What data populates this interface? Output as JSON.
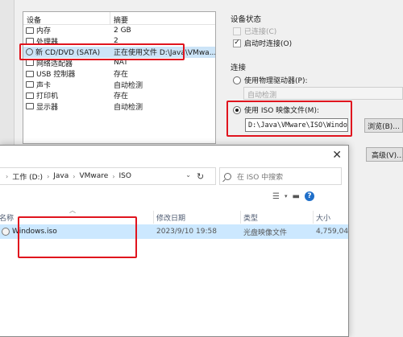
{
  "vm_dialog": {
    "device_table": {
      "col_device": "设备",
      "col_summary": "摘要",
      "rows": [
        {
          "name": "内存",
          "summary": "2 GB",
          "icon": "memory-icon"
        },
        {
          "name": "处理器",
          "summary": "2",
          "icon": "cpu-icon"
        },
        {
          "name": "新 CD/DVD (SATA)",
          "summary": "正在使用文件 D:\\Java\\VMwa...",
          "icon": "cd-icon"
        },
        {
          "name": "网络适配器",
          "summary": "NAT",
          "icon": "network-icon"
        },
        {
          "name": "USB 控制器",
          "summary": "存在",
          "icon": "usb-icon"
        },
        {
          "name": "声卡",
          "summary": "自动检测",
          "icon": "sound-icon"
        },
        {
          "name": "打印机",
          "summary": "存在",
          "icon": "printer-icon"
        },
        {
          "name": "显示器",
          "summary": "自动检测",
          "icon": "monitor-icon"
        }
      ]
    },
    "device_status": {
      "title": "设备状态",
      "connected": "已连接(C)",
      "connect_on_start": "启动时连接(O)",
      "connect_on_start_checked": true
    },
    "connection": {
      "title": "连接",
      "use_physical": "使用物理驱动器(P):",
      "auto_detect": "自动检测",
      "use_iso": "使用 ISO 映像文件(M):",
      "iso_path": "D:\\Java\\VMware\\ISO\\Windows",
      "browse": "浏览(B)...",
      "advanced": "高级(V)..."
    }
  },
  "file_dialog": {
    "breadcrumb": [
      "工作 (D:)",
      "Java",
      "VMware",
      "ISO"
    ],
    "search_placeholder": "在 ISO 中搜索",
    "columns": {
      "name": "名称",
      "modified": "修改日期",
      "type": "类型",
      "size": "大小"
    },
    "file": {
      "name": "Windows.iso",
      "modified": "2023/9/10 19:58",
      "type": "光盘映像文件",
      "size": "4,759,04"
    }
  },
  "colors": {
    "highlight_red": "#e0141e",
    "selected_row": "#cce8ff"
  }
}
